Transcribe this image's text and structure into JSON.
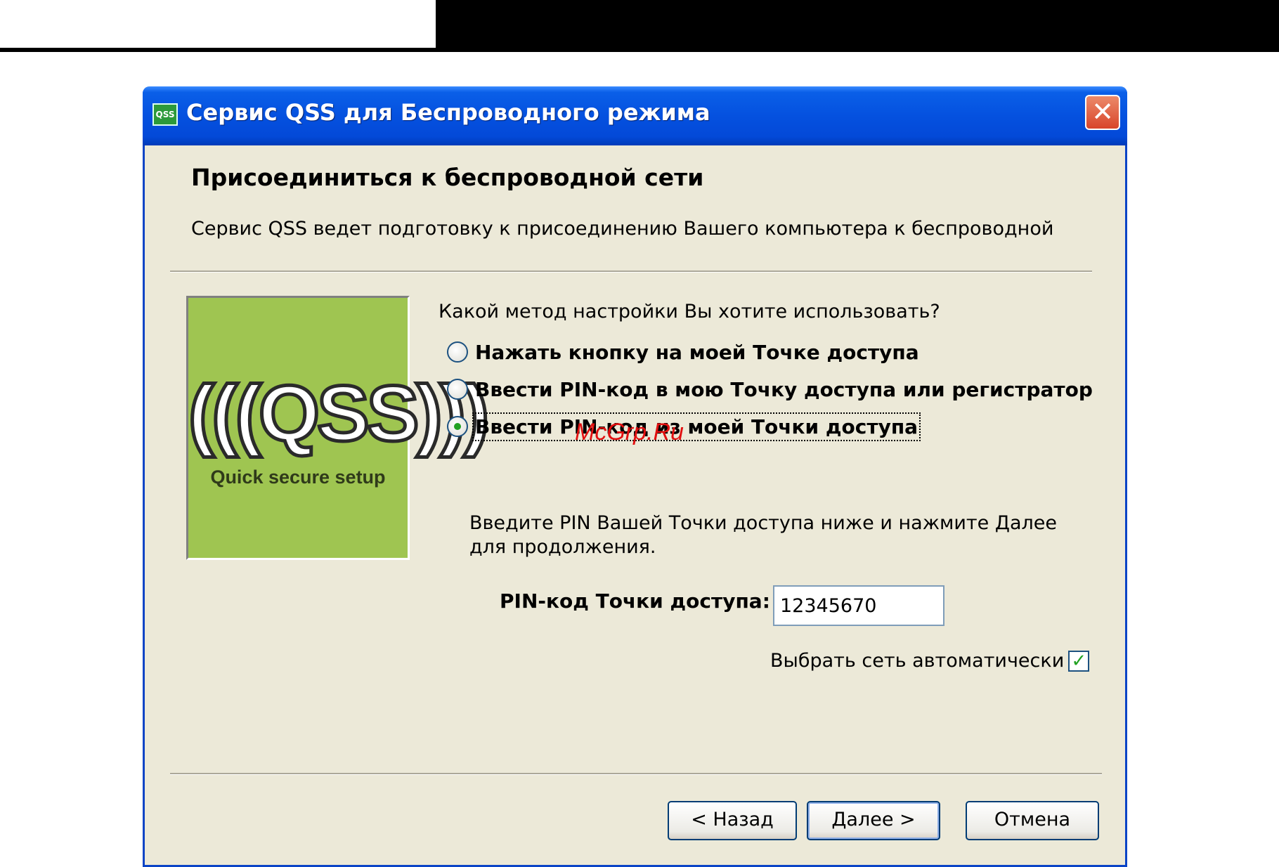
{
  "window": {
    "title": "Сервис QSS для Беспроводного режима",
    "icon_text": "QSS",
    "close_glyph": "✕"
  },
  "page": {
    "heading": "Присоединиться к беспроводной сети",
    "subtitle": "Сервис QSS ведет подготовку к присоединению Вашего компьютера к беспроводной"
  },
  "logo": {
    "mark": "(((QSS)))",
    "caption": "Quick secure setup",
    "background_color": "#9fc551"
  },
  "method": {
    "question": "Какой метод настройки Вы хотите использовать?",
    "options": [
      {
        "label": "Нажать кнопку на моей Точке доступа",
        "checked": false
      },
      {
        "label": "Ввести PIN-код в мою Точку доступа или регистратор",
        "checked": false
      },
      {
        "label": "Ввести PIN-код из моей Точки доступа",
        "checked": true
      }
    ]
  },
  "watermark": "McGrp.Ru",
  "pin": {
    "instructions": "Введите PIN Вашей Точки доступа ниже и нажмите Далее для продолжения.",
    "label": "PIN-код Точки доступа:",
    "value": "12345670"
  },
  "auto_select": {
    "label": "Выбрать сеть автоматически",
    "checked": true,
    "check_glyph": "✓"
  },
  "buttons": {
    "back": "< Назад",
    "next": "Далее >",
    "cancel": "Отмена"
  },
  "colors": {
    "titlebar": "#0551df",
    "dialog_bg": "#ece9d8",
    "radio_dot": "#21a121",
    "close_button": "#d8452a"
  }
}
